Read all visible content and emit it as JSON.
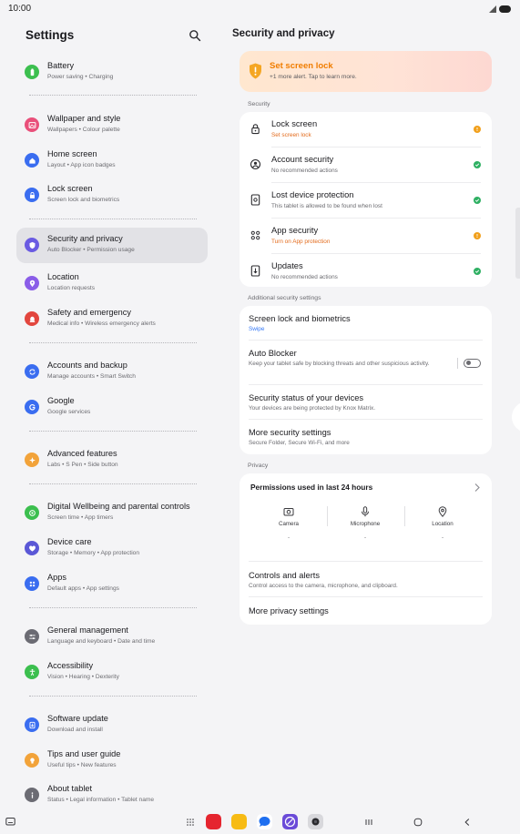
{
  "status_bar": {
    "time": "10:00"
  },
  "settings": {
    "title": "Settings",
    "items": [
      {
        "label": "Battery",
        "sub": "Power saving  •  Charging",
        "icon": "battery-icon",
        "color": "#3cbf4f"
      },
      {
        "label": "Wallpaper and style",
        "sub": "Wallpapers  •  Colour palette",
        "icon": "wallpaper-icon",
        "color": "#e94f7a"
      },
      {
        "label": "Home screen",
        "sub": "Layout  •  App icon badges",
        "icon": "home-icon",
        "color": "#3a6df0"
      },
      {
        "label": "Lock screen",
        "sub": "Screen lock and biometrics",
        "icon": "lock-icon",
        "color": "#3a6df0"
      },
      {
        "label": "Security and privacy",
        "sub": "Auto Blocker  •  Permission usage",
        "icon": "shield-icon",
        "color": "#6a5be2"
      },
      {
        "label": "Location",
        "sub": "Location requests",
        "icon": "location-pin-icon",
        "color": "#8a5de8"
      },
      {
        "label": "Safety and emergency",
        "sub": "Medical info  •  Wireless emergency alerts",
        "icon": "emergency-bell-icon",
        "color": "#e2463e"
      },
      {
        "label": "Accounts and backup",
        "sub": "Manage accounts  •  Smart Switch",
        "icon": "sync-icon",
        "color": "#3a6df0"
      },
      {
        "label": "Google",
        "sub": "Google services",
        "icon": "google-icon",
        "color": "#3a6df0"
      },
      {
        "label": "Advanced features",
        "sub": "Labs  •  S Pen  •  Side button",
        "icon": "star-icon",
        "color": "#f2a33a"
      },
      {
        "label": "Digital Wellbeing and parental controls",
        "sub": "Screen time  •  App timers",
        "icon": "wellbeing-icon",
        "color": "#3cbf4f"
      },
      {
        "label": "Device care",
        "sub": "Storage  •  Memory  •  App protection",
        "icon": "device-care-icon",
        "color": "#5a57d6"
      },
      {
        "label": "Apps",
        "sub": "Default apps  •  App settings",
        "icon": "apps-grid-icon",
        "color": "#3a6df0"
      },
      {
        "label": "General management",
        "sub": "Language and keyboard  •  Date and time",
        "icon": "sliders-icon",
        "color": "#6b6b73"
      },
      {
        "label": "Accessibility",
        "sub": "Vision  •  Hearing  •  Dexterity",
        "icon": "accessibility-icon",
        "color": "#3cbf4f"
      },
      {
        "label": "Software update",
        "sub": "Download and install",
        "icon": "update-icon",
        "color": "#3a6df0"
      },
      {
        "label": "Tips and user guide",
        "sub": "Useful tips  •  New features",
        "icon": "bulb-icon",
        "color": "#f2a33a"
      },
      {
        "label": "About tablet",
        "sub": "Status  •  Legal information  •  Tablet name",
        "icon": "info-icon",
        "color": "#6b6b73"
      }
    ]
  },
  "security": {
    "title": "Security and privacy",
    "alert": {
      "title": "Set screen lock",
      "sub": "+1 more alert. Tap to learn more."
    },
    "section_label": "Security",
    "rows": [
      {
        "label": "Lock screen",
        "sub": "Set screen lock",
        "icon": "lock-icon",
        "status": "warning"
      },
      {
        "label": "Account security",
        "sub": "No recommended actions",
        "icon": "account-icon",
        "status": "ok"
      },
      {
        "label": "Lost device protection",
        "sub": "This tablet is allowed to be found when lost",
        "icon": "tablet-icon",
        "status": "ok"
      },
      {
        "label": "App security",
        "sub": "Turn on App protection",
        "icon": "apps-icon",
        "status": "warning"
      },
      {
        "label": "Updates",
        "sub": "No recommended actions",
        "icon": "update-icon",
        "status": "ok"
      }
    ],
    "additional_label": "Additional security settings",
    "additional": [
      {
        "label": "Screen lock and biometrics",
        "sub": "Swipe"
      },
      {
        "label": "Auto Blocker",
        "sub": "Keep your tablet safe by blocking threats and other suspicious activity.",
        "toggle": "off"
      },
      {
        "label": "Security status of your devices",
        "sub": "Your devices are being protected by Knox Matrix."
      },
      {
        "label": "More security settings",
        "sub": "Secure Folder, Secure Wi-Fi, and more"
      }
    ],
    "privacy_label": "Privacy",
    "permissions": {
      "title": "Permissions used in last 24 hours",
      "items": [
        {
          "label": "Camera",
          "value": "-"
        },
        {
          "label": "Microphone",
          "value": "-"
        },
        {
          "label": "Location",
          "value": "-"
        }
      ]
    },
    "controls": {
      "label": "Controls and alerts",
      "sub": "Control access to the camera, microphone, and clipboard."
    },
    "more_privacy": "More privacy settings"
  },
  "colors": {
    "warning": "#f1a01c",
    "ok": "#2fb063",
    "alert_title": "#f07d00",
    "link_blue": "#3478f6"
  },
  "taskbar": {
    "apps": [
      {
        "name": "notes-icon",
        "color": "#e5252f"
      },
      {
        "name": "files-icon",
        "color": "#f7bb14"
      },
      {
        "name": "messages-icon",
        "color": "#1f6ff0"
      },
      {
        "name": "internet-icon",
        "color": "#6a4ad8"
      },
      {
        "name": "camera-icon",
        "color": "#d8d8dc"
      }
    ]
  }
}
